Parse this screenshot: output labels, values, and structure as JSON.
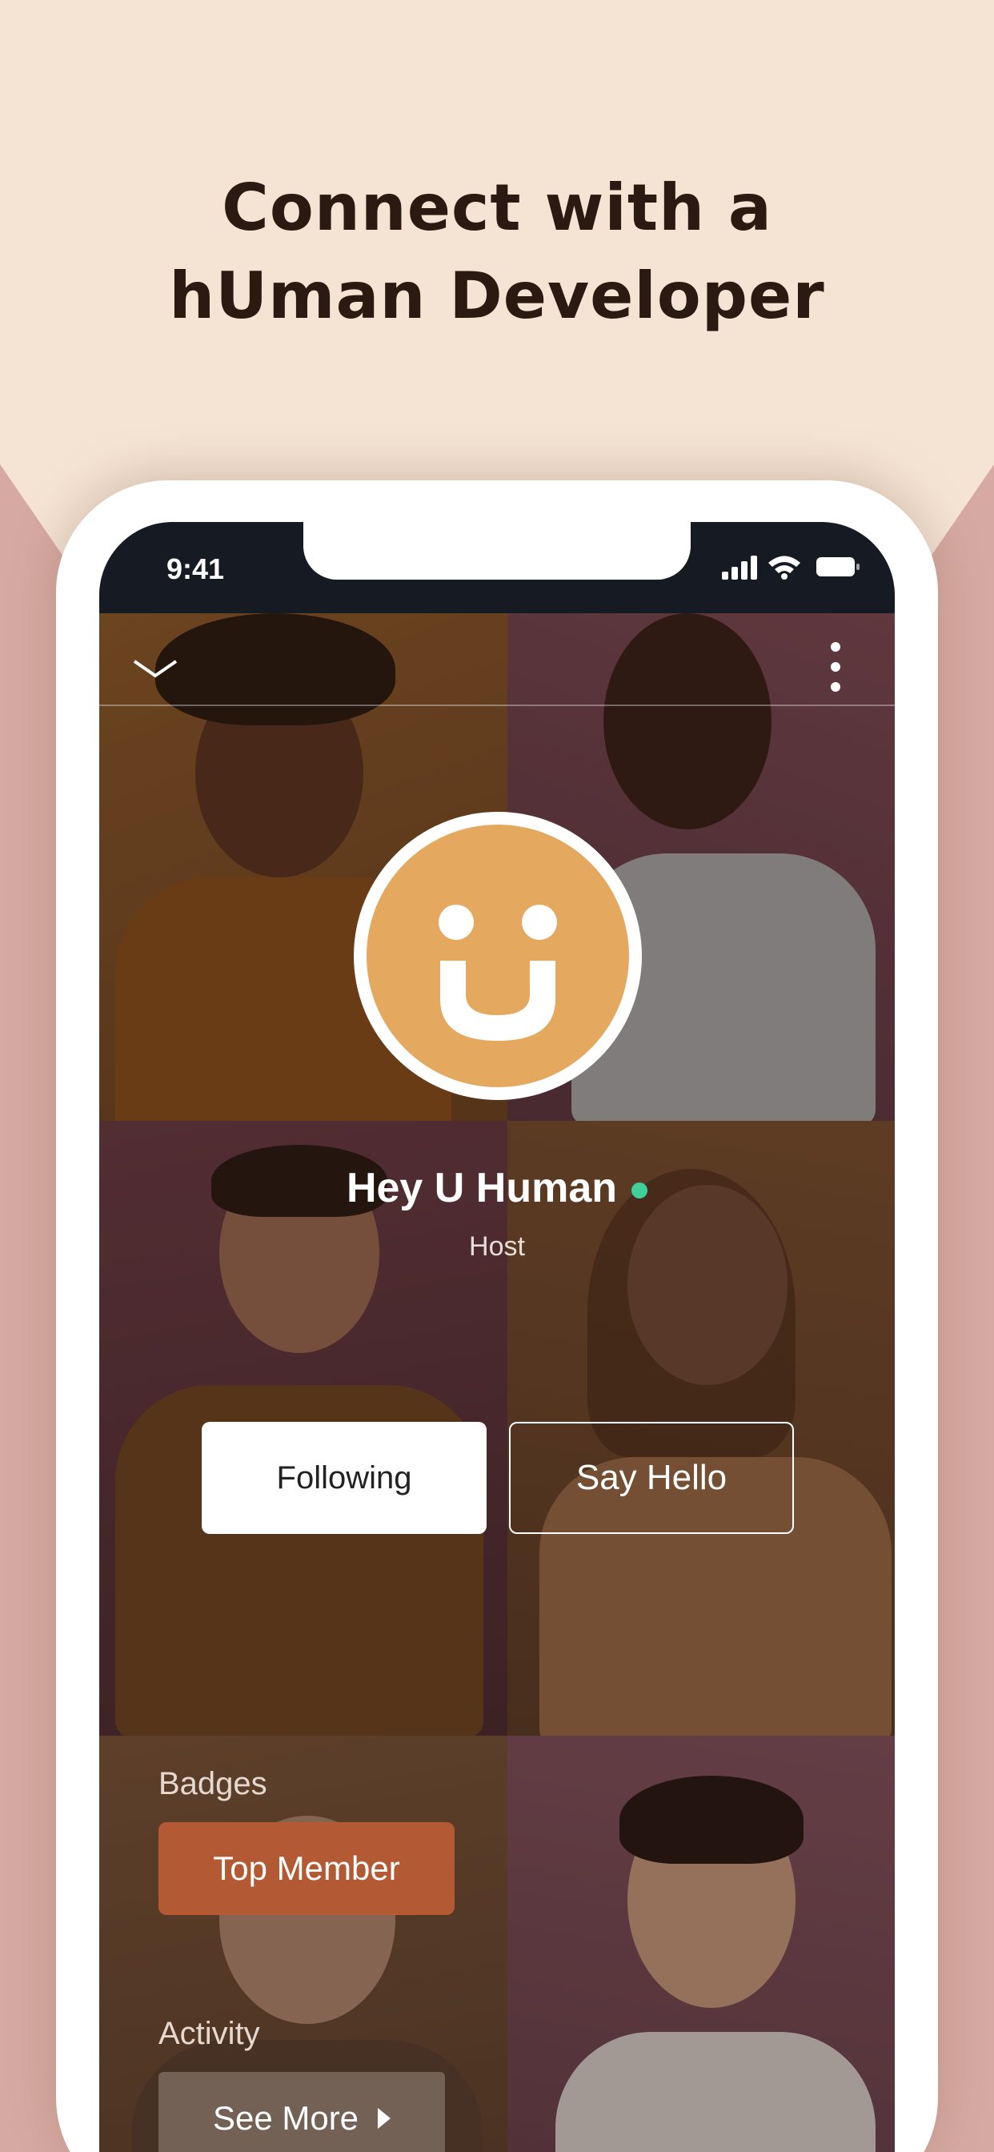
{
  "headline": {
    "line1": "Connect with a",
    "line2": "hUman Developer"
  },
  "status": {
    "time": "9:41"
  },
  "profile": {
    "name": "Hey U Human",
    "role": "Host",
    "online_color": "#3ecf9a"
  },
  "actions": {
    "following": "Following",
    "say_hello": "Say Hello"
  },
  "badges": {
    "label": "Badges",
    "items": [
      "Top Member"
    ]
  },
  "activity": {
    "label": "Activity",
    "see_more": "See More"
  },
  "colors": {
    "background": "#f5e4d4",
    "accent_badge": "#b35a34",
    "avatar": "#e4a85e"
  }
}
